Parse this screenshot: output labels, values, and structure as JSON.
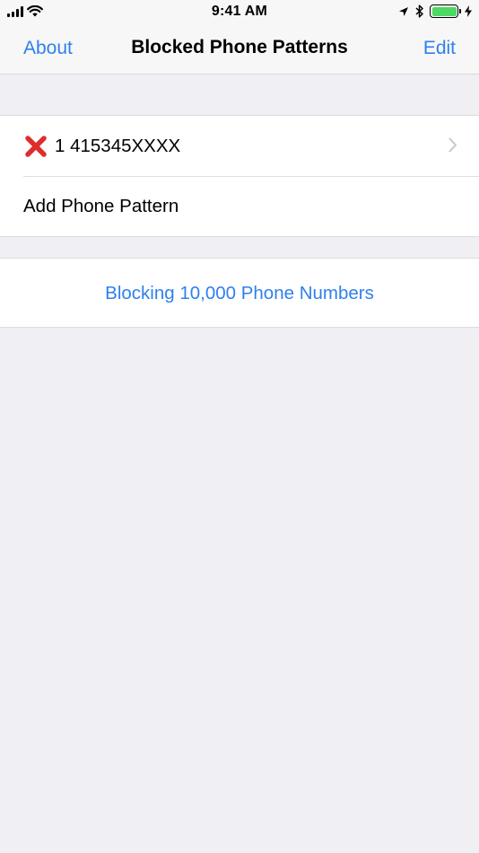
{
  "status_bar": {
    "time": "9:41 AM",
    "battery_level": 1.0,
    "icons": [
      "signal-icon",
      "wifi-icon",
      "location-icon",
      "bluetooth-icon",
      "battery-icon",
      "charging-icon"
    ]
  },
  "nav": {
    "left_label": "About",
    "title": "Blocked Phone Patterns",
    "right_label": "Edit"
  },
  "patterns": [
    {
      "icon": "red-x-icon",
      "pattern": "1 415345XXXX"
    }
  ],
  "add_row_label": "Add Phone Pattern",
  "footer": {
    "blocking_label": "Blocking 10,000 Phone Numbers"
  },
  "colors": {
    "accent": "#2f80ed",
    "background": "#efeff4",
    "battery": "#4cd964",
    "delete_x": "#dd2e2e"
  }
}
